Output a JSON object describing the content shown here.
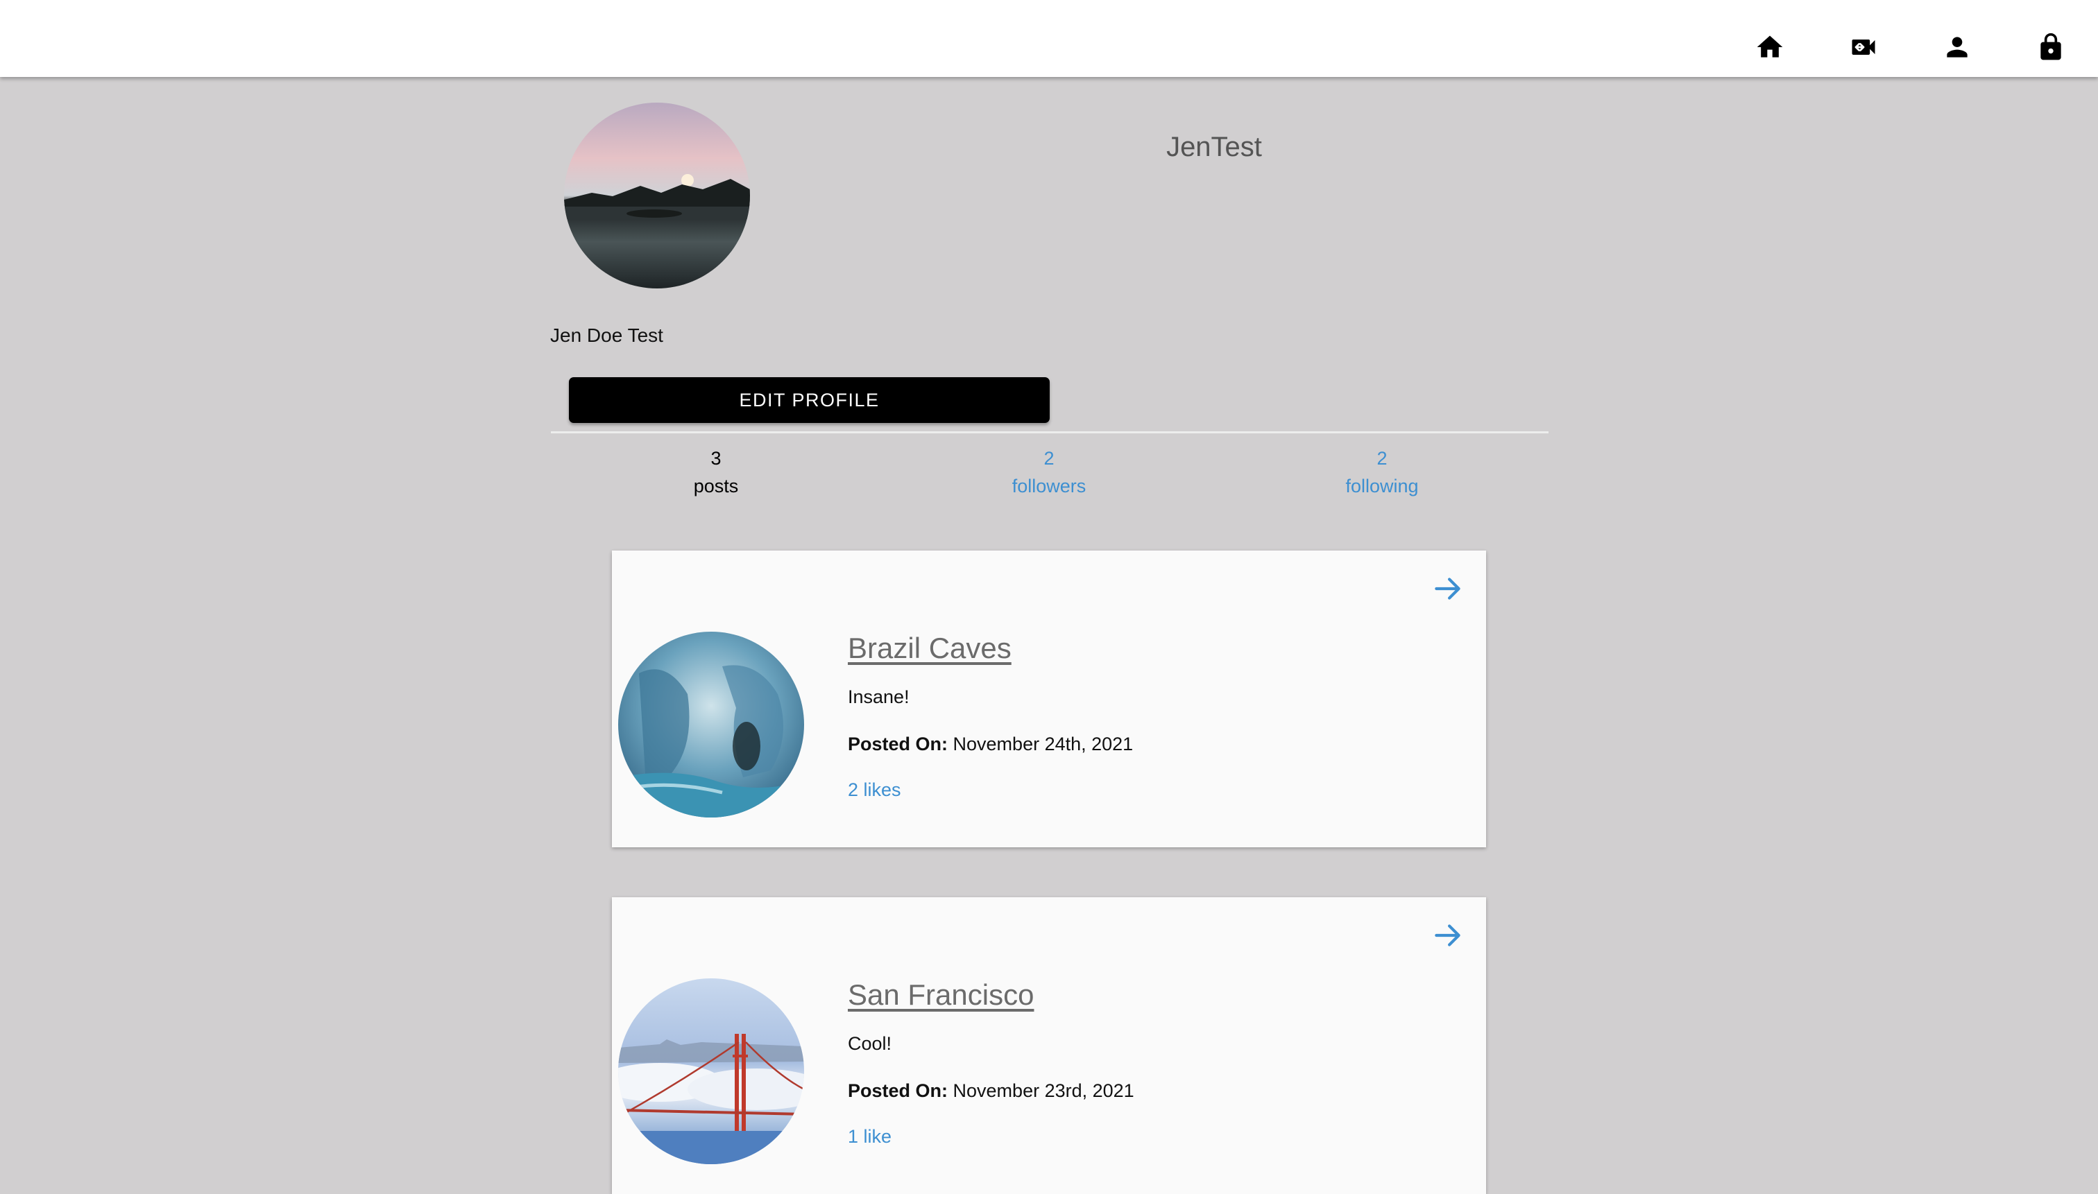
{
  "nav": {
    "icons": [
      "home-icon",
      "video-call-icon",
      "person-icon",
      "lock-icon"
    ]
  },
  "profile": {
    "username": "JenTest",
    "full_name": "Jen Doe Test",
    "edit_button": "EDIT PROFILE"
  },
  "stats": {
    "posts": {
      "count": "3",
      "label": "posts"
    },
    "followers": {
      "count": "2",
      "label": "followers"
    },
    "following": {
      "count": "2",
      "label": "following"
    }
  },
  "posts": [
    {
      "title": "Brazil Caves",
      "description": "Insane!",
      "posted_label": "Posted On:",
      "date": "November 24th, 2021",
      "likes": "2 likes"
    },
    {
      "title": "San Francisco",
      "description": "Cool!",
      "posted_label": "Posted On:",
      "date": "November 23rd, 2021",
      "likes": "1 like"
    }
  ],
  "colors": {
    "background": "#d1cfd0",
    "appbar": "#ffffff",
    "link": "#3d8fd1",
    "button": "#000000"
  }
}
